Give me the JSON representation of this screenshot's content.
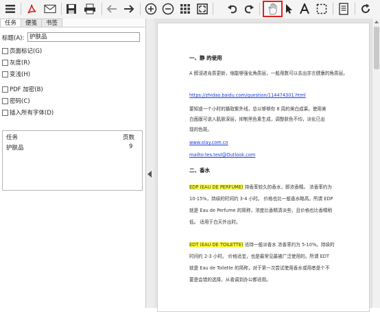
{
  "toolbar": {
    "buttons": [
      {
        "name": "menu-icon"
      },
      {
        "name": "pdf-icon"
      },
      {
        "name": "mail-icon"
      },
      {
        "name": "save-icon"
      },
      {
        "name": "print-icon"
      },
      {
        "name": "back-arrow-icon"
      },
      {
        "name": "forward-arrow-icon"
      },
      {
        "name": "zoom-in-icon"
      },
      {
        "name": "zoom-out-icon"
      },
      {
        "name": "grid-icon"
      },
      {
        "name": "fit-page-icon"
      },
      {
        "name": "undo-icon"
      },
      {
        "name": "redo-icon"
      },
      {
        "name": "hand-tool-icon"
      },
      {
        "name": "select-arrow-icon"
      },
      {
        "name": "text-tool-icon"
      },
      {
        "name": "marquee-select-icon"
      },
      {
        "name": "document-icon"
      },
      {
        "name": "refresh-icon"
      }
    ],
    "active_color": "#e02020"
  },
  "left": {
    "tabs": [
      "任务",
      "便笺",
      "书签"
    ],
    "title_label": "标题(A):",
    "title_value": "护肤品",
    "checkboxes": [
      "页面标记(G)",
      "灰度(R)",
      "变浅(H)",
      "PDF 加密(B)",
      "密码(C)",
      "插入所有字体(D)"
    ],
    "table": {
      "col_task": "任务",
      "col_pages": "页数",
      "row_task": "护肤品",
      "row_pages": "9"
    }
  },
  "doc": {
    "h1": "一、静 的使用",
    "p1": "A 醇浸进肯质更新，缩能够强化角质层，一般用数可以去出亦言健康的角质层。",
    "link1": "https://zhidao.baidu.com/question/114474301.html",
    "p2a": "要知道一个小时的猫取紫外线，总以够够你 8 周的美白成果。使用美",
    "p2b": "白面膜可说入肌肤深层，抑制黑色素生成，调整肤色不均，淡化已出",
    "p2c": "现的色斑。",
    "link2": "www.olay.com.cn",
    "link3": "mailto:tes.test@Outlook.com",
    "h2": "二、香水",
    "edp_tag": "EDP (EAU DE PERFUME)",
    "p3a": " 持香率较久的香水，即浓香精。 浓香率约为",
    "p3b": "10-15%，持续的时间约 3-4 小时。 价格也比一般香水略高。所谓 EDP",
    "p3c": "就是 Eau de Perfume 的简称，浓度比香精清淡些，且价格也比香精稍",
    "p3d": "低。 适用于白天外出时。",
    "edt_tag": "EDT (EAU DE TOILETTE)",
    "p4a": " 适持一般淡香水  浓香率约为 5-10%。持续的",
    "p4b": "时间约 2-3 小时。 价格适宜，也是最常见最被广泛使用的。所谓 EDT",
    "p4c": "就是 Eau de Toilette 的简称，对于第一次尝试使用香水或用者是个不",
    "p4d": "要是会错的选择，从香调到办公都适用。"
  }
}
